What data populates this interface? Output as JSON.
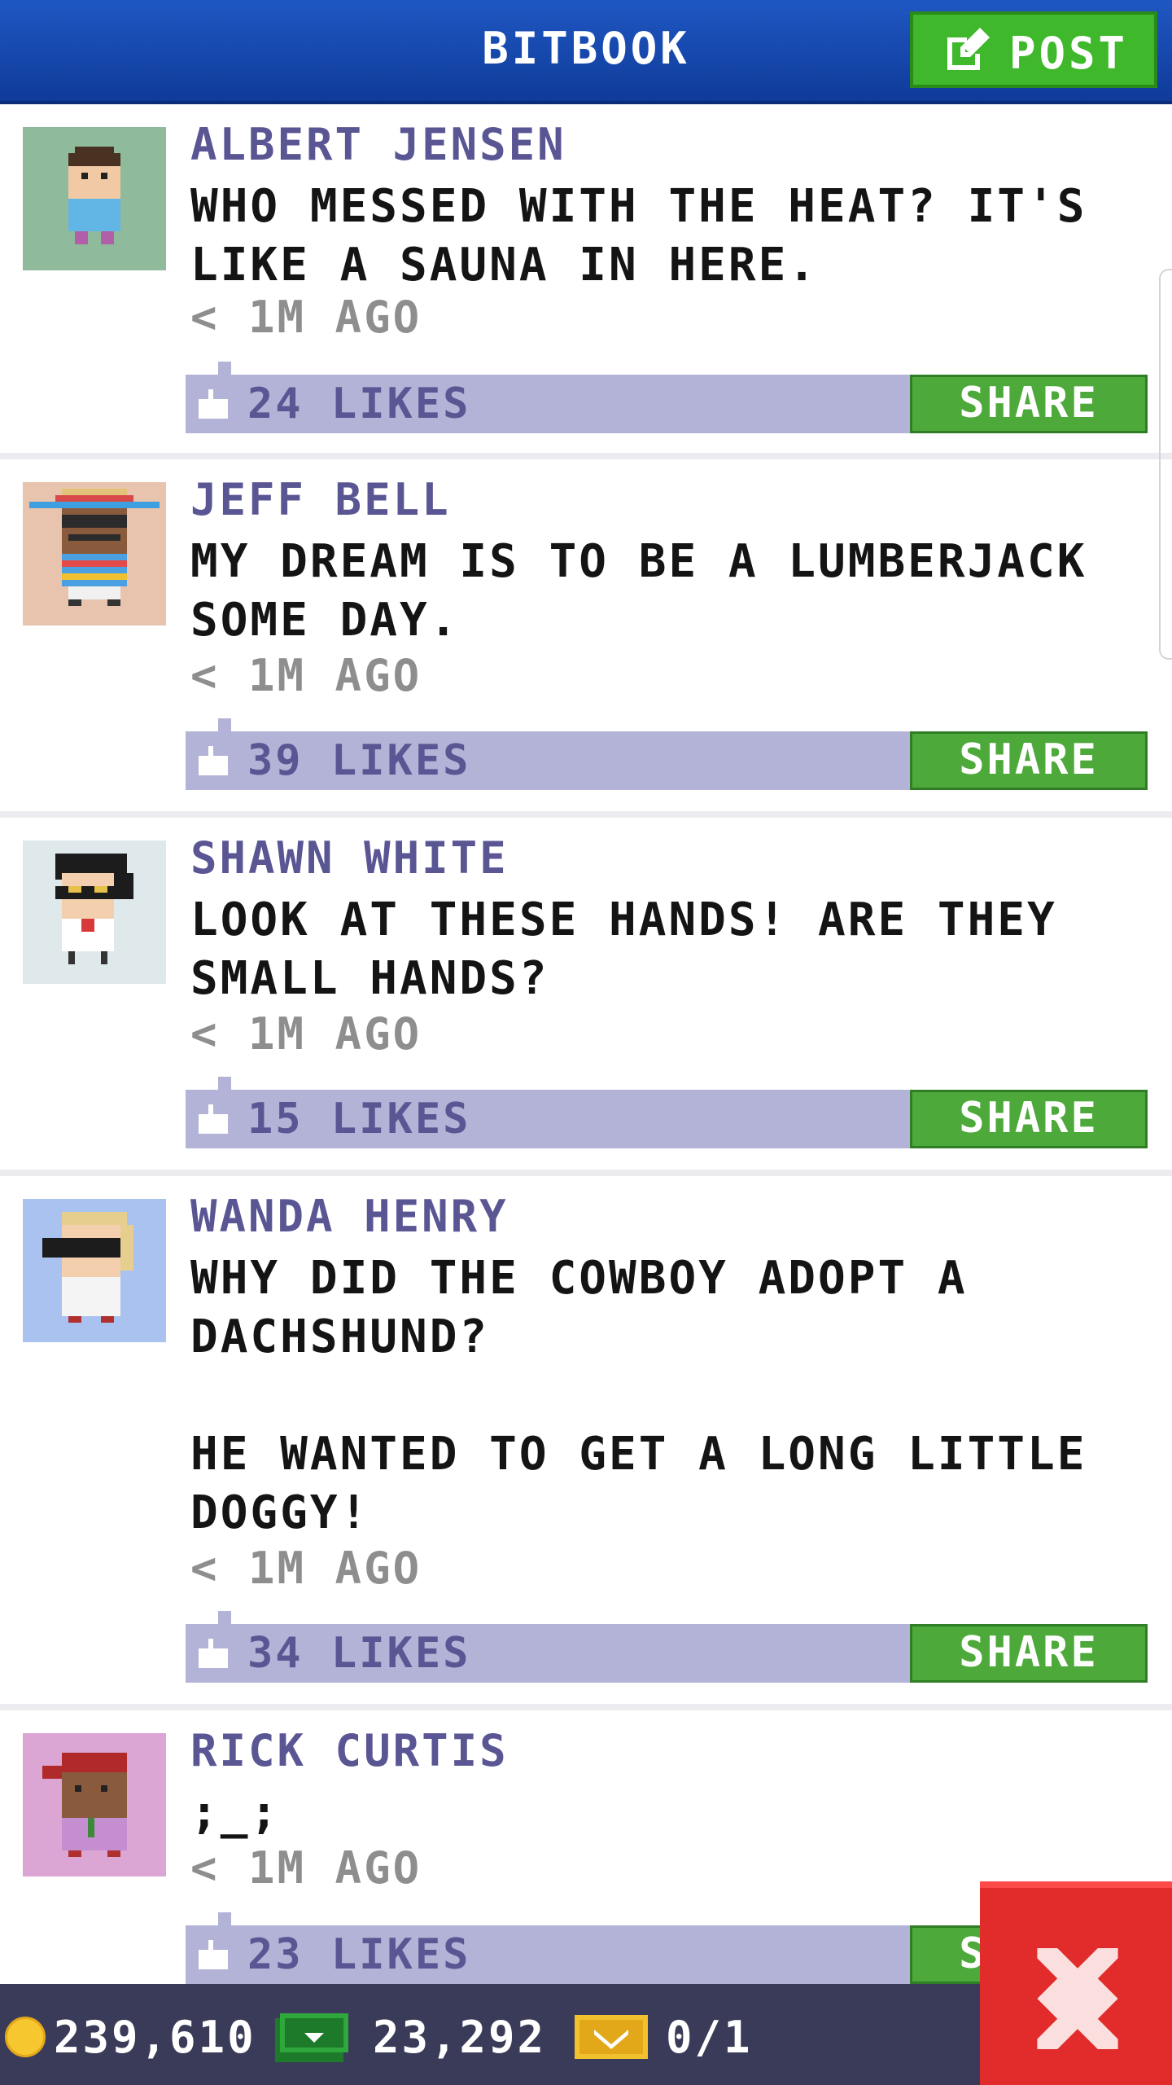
{
  "app": {
    "title": "BITBOOK",
    "post_label": "POST",
    "share_label": "SHARE"
  },
  "posts": [
    {
      "author": "ALBERT JENSEN",
      "text": "WHO MESSED WITH THE HEAT? IT'S LIKE A SAUNA IN HERE.",
      "time": "< 1M AGO",
      "likes": "24 LIKES",
      "avatar_color": "#8fba9b"
    },
    {
      "author": "JEFF BELL",
      "text": "MY DREAM IS TO BE A LUMBERJACK SOME DAY.",
      "time": "< 1M AGO",
      "likes": "39 LIKES",
      "avatar_color": "#e8c4ae"
    },
    {
      "author": "SHAWN WHITE",
      "text": "LOOK AT THESE HANDS! ARE THEY SMALL HANDS?",
      "time": "< 1M AGO",
      "likes": "15 LIKES",
      "avatar_color": "#dfe9ec"
    },
    {
      "author": "WANDA HENRY",
      "text": "WHY DID THE COWBOY ADOPT A DACHSHUND?\n\nHE WANTED TO GET A LONG LITTLE DOGGY!",
      "time": "< 1M AGO",
      "likes": "34 LIKES",
      "avatar_color": "#aac2ef"
    },
    {
      "author": "RICK CURTIS",
      "text": ";_;",
      "time": "< 1M AGO",
      "likes": "23 LIKES",
      "avatar_color": "#dca6d4"
    }
  ],
  "status_bar": {
    "coins": "239,610",
    "bux": "23,292",
    "tickets": "0/1"
  },
  "colors": {
    "header": "#1f57c2",
    "post_button": "#3fb82c",
    "share_button": "#4daa3a",
    "likes_bar": "#b2b3d6",
    "author_text": "#5a5694",
    "close_button": "#e22b2b"
  }
}
